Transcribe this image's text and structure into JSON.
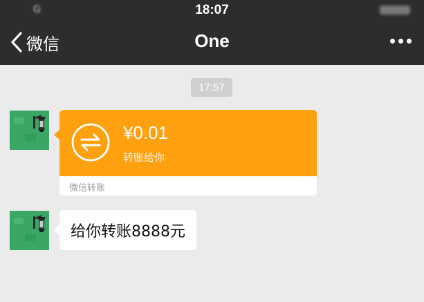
{
  "status_bar": {
    "carrier": "G",
    "time": "18:07"
  },
  "nav": {
    "back_label": "微信",
    "title": "One"
  },
  "chat": {
    "timestamp": "17:57",
    "transfer": {
      "amount": "¥0.01",
      "description": "转账给你",
      "source": "微信转账"
    },
    "text_message": "给你转账8888元"
  },
  "colors": {
    "bar_bg": "#2d2d2f",
    "chat_bg": "#ebebeb",
    "transfer_orange": "#ffa00f",
    "avatar_green": "#3aa766"
  },
  "icons": [
    "back-chevron-icon",
    "more-icon",
    "transfer-arrows-icon"
  ]
}
